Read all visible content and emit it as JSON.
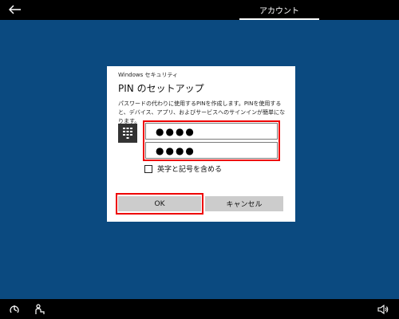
{
  "topbar": {
    "back_icon": "back-arrow-icon",
    "tab_label": "アカウント"
  },
  "dialog": {
    "caption": "Windows セキュリティ",
    "title": "PIN のセットアップ",
    "description": "パスワードの代わりに使用するPINを作成します。PINを使用すると、デバイス、アプリ、およびサービスへのサインインが簡単になります。",
    "keypad_icon": "keypad-icon",
    "pin_value": "●●●●",
    "confirm_pin_value": "●●●●",
    "checkbox_label": "英字と記号を含める",
    "checkbox_checked": false,
    "ok_label": "OK",
    "cancel_label": "キャンセル"
  },
  "bottombar": {
    "left_icons": [
      "ease-of-access-icon",
      "accessibility-person-icon"
    ],
    "right_icon": "volume-icon"
  },
  "colors": {
    "background": "#0b4a80",
    "bars": "#000000",
    "highlight": "#ee0000",
    "button": "#cccccc"
  }
}
